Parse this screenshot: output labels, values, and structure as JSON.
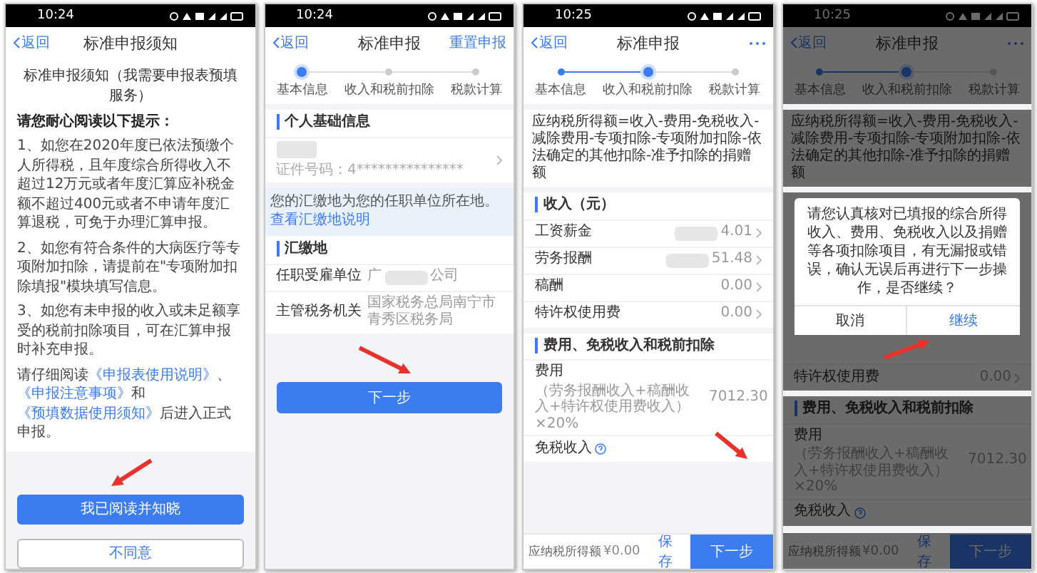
{
  "phones": [
    {
      "status_time": "10:24",
      "nav": {
        "back": "返回",
        "title": "标准申报须知"
      },
      "blocks": [
        {
          "kind": "notice",
          "heading": "标准申报须知（我需要申报表预填服务）",
          "intro": "请您耐心阅读以下提示：",
          "paragraphs": [
            "1、如您在2020年度已依法预缴个人所得税，且年度综合所得收入不超过12万元或者年度汇算应补税金额不超过400元或者不申请年度汇算退税，可免于办理汇算申报。",
            "2、如您有符合条件的大病医疗等专项附加扣除，请提前在\"专项附加扣除填报\"模块填写信息。",
            "3、如您有未申报的收入或未足额享受的税前扣除项目，可在汇算申报时补充申报。"
          ],
          "closing": [
            {
              "text": "请仔细阅读",
              "link": false
            },
            {
              "text": "《申报表使用说明》",
              "link": true
            },
            {
              "text": "、",
              "link": false
            },
            {
              "text": "《申报注意事项》",
              "link": true
            },
            {
              "text": "和",
              "link": false
            },
            {
              "text": "《预填数据使用须知》",
              "link": true
            },
            {
              "text": "后进入正式申报。",
              "link": false
            }
          ]
        },
        {
          "kind": "primary_button",
          "label": "我已阅读并知晓"
        },
        {
          "kind": "secondary_button",
          "label": "不同意"
        }
      ]
    },
    {
      "status_time": "10:24",
      "nav": {
        "back": "返回",
        "title": "标准申报",
        "action": "重置申报"
      },
      "blocks": [
        {
          "kind": "steps",
          "steps": [
            {
              "label": "基本信息",
              "active": true,
              "current": true
            },
            {
              "label": "收入和税前扣除",
              "active": false,
              "current": false
            },
            {
              "label": "税款计算",
              "active": false,
              "current": false
            }
          ]
        },
        {
          "kind": "section",
          "title": "个人基础信息",
          "rows": [
            {
              "label": "",
              "value_before": "",
              "value": "证件号码：4***************",
              "redacted": true,
              "id_row": true,
              "chevron": true,
              "help": false
            }
          ]
        },
        {
          "kind": "info",
          "text": "您的汇缴地为您的任职单位所在地。",
          "link": "查看汇缴地说明"
        },
        {
          "kind": "section",
          "title": "汇缴地",
          "rows": [
            {
              "label": "任职受雇单位",
              "value_before": "广",
              "value": "公司",
              "redacted": true,
              "id_row": false,
              "chevron": false,
              "help": false
            },
            {
              "label": "主管税务机关",
              "value_before": "",
              "value": "国家税务总局南宁市青秀区税务局",
              "redacted": false,
              "id_row": false,
              "chevron": false,
              "help": false
            }
          ]
        },
        {
          "kind": "primary_button",
          "label": "下一步"
        }
      ]
    },
    {
      "status_time": "10:25",
      "nav": {
        "back": "返回",
        "title": "标准申报",
        "more": true
      },
      "blocks": [
        {
          "kind": "steps",
          "steps": [
            {
              "label": "基本信息",
              "active": true,
              "current": false
            },
            {
              "label": "收入和税前扣除",
              "active": true,
              "current": true
            },
            {
              "label": "税款计算",
              "active": false,
              "current": false
            }
          ]
        },
        {
          "kind": "formula",
          "text": "应纳税所得额=收入-费用-免税收入-减除费用-专项扣除-专项附加扣除-依法确定的其他扣除-准予扣除的捐赠额"
        },
        {
          "kind": "section",
          "title": "收入（元）",
          "rows": [
            {
              "label": "工资薪金",
              "value_before": "",
              "value": "4.01",
              "redacted": true,
              "id_row": false,
              "chevron": true,
              "help": false
            },
            {
              "label": "劳务报酬",
              "value_before": "",
              "value": "51.48",
              "redacted": true,
              "id_row": false,
              "chevron": true,
              "help": false
            },
            {
              "label": "稿酬",
              "value_before": "",
              "value": "0.00",
              "redacted": false,
              "id_row": false,
              "chevron": true,
              "help": false
            },
            {
              "label": "特许权使用费",
              "value_before": "",
              "value": "0.00",
              "redacted": false,
              "id_row": false,
              "chevron": true,
              "help": false
            }
          ]
        },
        {
          "kind": "section",
          "title": "费用、免税收入和税前扣除",
          "rows": [
            {
              "label": "费用",
              "note": "（劳务报酬收入+稿酬收入+特许权使用费收入）×20%",
              "value_before": "",
              "value": "7012.30",
              "redacted": false,
              "id_row": false,
              "chevron": false,
              "help": false
            },
            {
              "label": "免税收入",
              "value_before": "",
              "value": "",
              "redacted": false,
              "id_row": false,
              "chevron": false,
              "help": true
            }
          ]
        },
        {
          "kind": "bottom_bar",
          "label": "应纳税所得额",
          "amount": "¥0.00",
          "save": "保存",
          "next": "下一步"
        }
      ]
    },
    {
      "status_time": "10:25",
      "nav": {
        "back": "返回",
        "title": "标准申报",
        "more": true
      },
      "blocks": [
        {
          "kind": "steps",
          "steps": [
            {
              "label": "基本信息",
              "active": true,
              "current": false
            },
            {
              "label": "收入和税前扣除",
              "active": true,
              "current": true
            },
            {
              "label": "税款计算",
              "active": false,
              "current": false
            }
          ]
        },
        {
          "kind": "formula",
          "text": "应纳税所得额=收入-费用-免税收入-减除费用-专项扣除-专项附加扣除-依法确定的其他扣除-准予扣除的捐赠额"
        },
        {
          "kind": "dialog",
          "message": "请您认真核对已填报的综合所得收入、费用、免税收入以及捐赠等各项扣除项目，有无漏报或错误，确认无误后再进行下一步操作，是否继续？",
          "buttons": [
            {
              "label": "取消",
              "primary": false
            },
            {
              "label": "继续",
              "primary": true
            }
          ]
        },
        {
          "kind": "section",
          "rows": [
            {
              "label": "特许权使用费",
              "value_before": "",
              "value": "0.00",
              "redacted": false,
              "id_row": false,
              "chevron": true,
              "help": false
            }
          ]
        },
        {
          "kind": "section",
          "title": "费用、免税收入和税前扣除",
          "rows": [
            {
              "label": "费用",
              "note": "（劳务报酬收入+稿酬收入+特许权使用费收入）×20%",
              "value_before": "",
              "value": "7012.30",
              "redacted": false,
              "id_row": false,
              "chevron": false,
              "help": false
            },
            {
              "label": "免税收入",
              "value_before": "",
              "value": "",
              "redacted": false,
              "id_row": false,
              "chevron": false,
              "help": true
            }
          ]
        },
        {
          "kind": "bottom_bar",
          "label": "应纳税所得额",
          "amount": "¥0.00",
          "save": "保存",
          "next": "下一步"
        }
      ]
    }
  ]
}
